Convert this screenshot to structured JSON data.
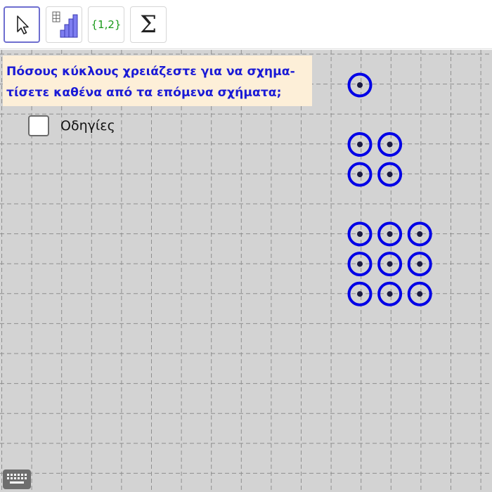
{
  "toolbar": {
    "tools": [
      {
        "icon": "move-arrow-icon",
        "active": true
      },
      {
        "icon": "bar-chart-icon",
        "active": false
      },
      {
        "icon": "list-icon",
        "label": "{1,2}",
        "active": false
      },
      {
        "icon": "sigma-icon",
        "label": "Σ",
        "active": false
      }
    ]
  },
  "question": {
    "line1": "Πόσους κύκλους χρειάζεστε για να σχημα-",
    "line2": "τίσετε καθένα από τα επόμενα σχήματα;"
  },
  "instructions_checkbox": {
    "label": "Οδηγίες",
    "checked": false
  },
  "figures": [
    {
      "rows": 1,
      "cols": 1
    },
    {
      "rows": 2,
      "cols": 2
    },
    {
      "rows": 3,
      "cols": 3
    }
  ],
  "colors": {
    "circle": "#0000e6",
    "grid_background": "#d3d3d3",
    "question_background": "#fdefd8",
    "question_text": "#1a1ad6"
  },
  "keyboard": {
    "icon": "keyboard-icon"
  }
}
